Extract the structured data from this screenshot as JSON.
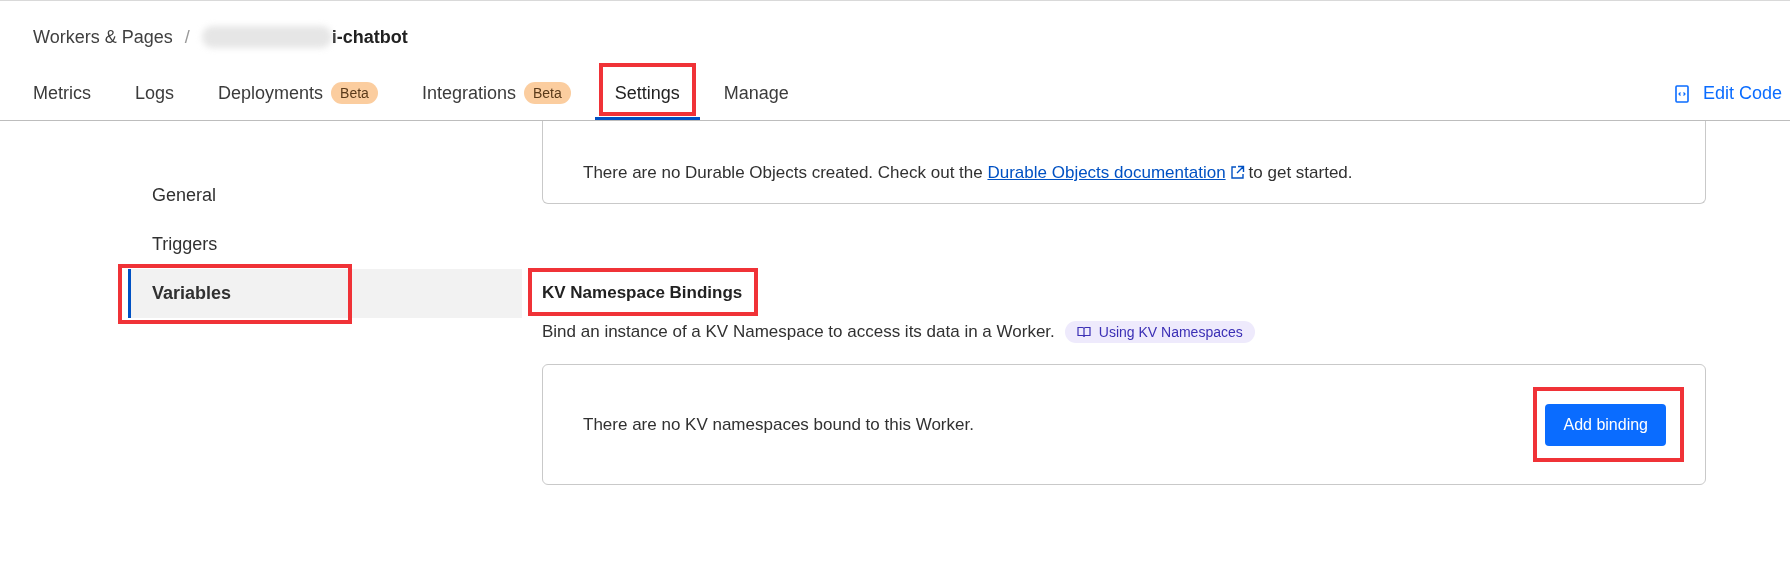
{
  "breadcrumb": {
    "root": "Workers & Pages",
    "separator": "/",
    "current": "i-chatbot"
  },
  "tabs": [
    {
      "label": "Metrics",
      "selected": false,
      "highlighted": false
    },
    {
      "label": "Logs",
      "selected": false,
      "highlighted": false
    },
    {
      "label": "Deployments",
      "badge": "Beta",
      "selected": false,
      "highlighted": false
    },
    {
      "label": "Integrations",
      "badge": "Beta",
      "selected": false,
      "highlighted": false
    },
    {
      "label": "Settings",
      "selected": true,
      "highlighted": true
    },
    {
      "label": "Manage",
      "selected": false,
      "highlighted": false
    }
  ],
  "edit_code": {
    "label": "Edit Code"
  },
  "sidebar": {
    "items": [
      {
        "label": "General",
        "selected": false,
        "highlighted": false
      },
      {
        "label": "Triggers",
        "selected": false,
        "highlighted": false
      },
      {
        "label": "Variables",
        "selected": true,
        "highlighted": true
      }
    ]
  },
  "durable_objects": {
    "text_before": "There are no Durable Objects created. Check out the",
    "link": "Durable Objects documentation",
    "text_after": "to get started."
  },
  "kv": {
    "title": "KV Namespace Bindings",
    "title_highlighted": true,
    "description": "Bind an instance of a KV Namespace to access its data in a Worker.",
    "doc_link": "Using KV Namespaces",
    "empty_text": "There are no KV namespaces bound to this Worker.",
    "button": "Add binding",
    "button_highlighted": true
  }
}
